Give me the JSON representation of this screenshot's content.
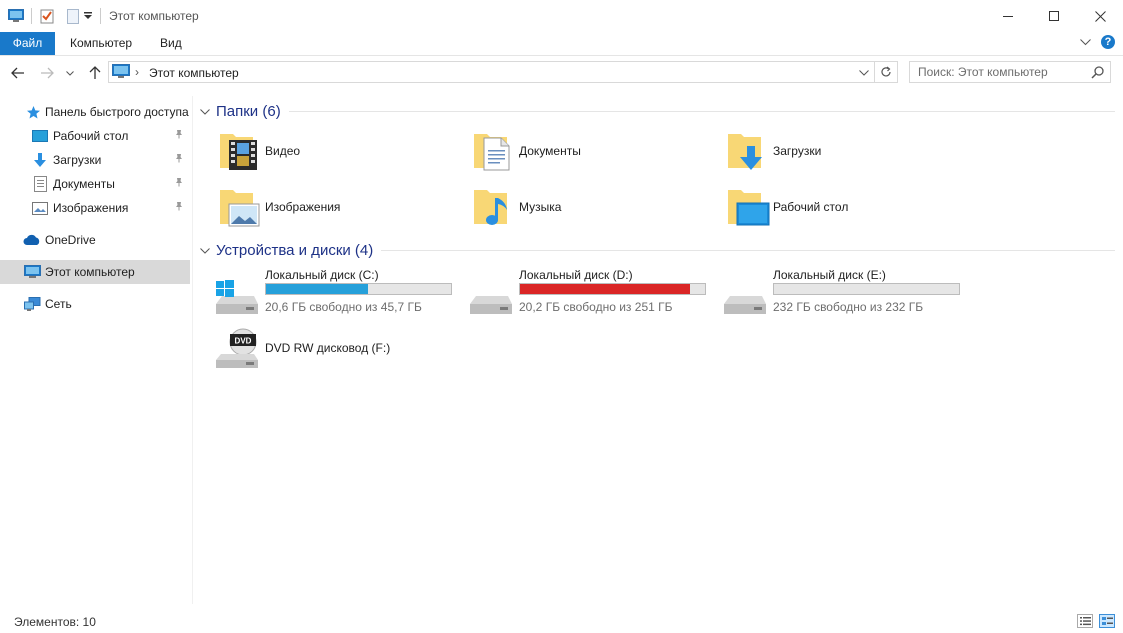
{
  "window": {
    "title": "Этот компьютер",
    "minimize": "—",
    "maximize": "☐",
    "close": "✕"
  },
  "ribbon": {
    "tabs": [
      {
        "label": "Файл"
      },
      {
        "label": "Компьютер"
      },
      {
        "label": "Вид"
      }
    ],
    "help": "?"
  },
  "address": {
    "path": "Этот компьютер",
    "search_placeholder": "Поиск: Этот компьютер"
  },
  "nav": {
    "quick_access": "Панель быстрого доступа",
    "items": [
      {
        "label": "Рабочий стол",
        "pinned": true
      },
      {
        "label": "Загрузки",
        "pinned": true
      },
      {
        "label": "Документы",
        "pinned": true
      },
      {
        "label": "Изображения",
        "pinned": true
      }
    ],
    "onedrive": "OneDrive",
    "this_pc": "Этот компьютер",
    "network": "Сеть"
  },
  "folders": {
    "header": "Папки (6)",
    "items": [
      {
        "label": "Видео",
        "icon": "video-folder-icon"
      },
      {
        "label": "Документы",
        "icon": "documents-folder-icon"
      },
      {
        "label": "Загрузки",
        "icon": "downloads-folder-icon"
      },
      {
        "label": "Изображения",
        "icon": "pictures-folder-icon"
      },
      {
        "label": "Музыка",
        "icon": "music-folder-icon"
      },
      {
        "label": "Рабочий стол",
        "icon": "desktop-folder-icon"
      }
    ]
  },
  "drives": {
    "header": "Устройства и диски (4)",
    "items": [
      {
        "name": "Локальный диск (C:)",
        "free_text": "20,6 ГБ свободно из 45,7 ГБ",
        "used_fraction": 0.55,
        "bar_color": "#26a0da"
      },
      {
        "name": "Локальный диск (D:)",
        "free_text": "20,2 ГБ свободно из 251 ГБ",
        "used_fraction": 0.92,
        "bar_color": "#da2626"
      },
      {
        "name": "Локальный диск (E:)",
        "free_text": "232 ГБ свободно из 232 ГБ",
        "used_fraction": 0.0,
        "bar_color": "#26a0da"
      },
      {
        "name": "DVD RW дисковод (F:)",
        "free_text": "",
        "used_fraction": null,
        "bar_color": ""
      }
    ]
  },
  "status": {
    "items_count": "Элементов: 10"
  },
  "colors": {
    "accent": "#1979ca",
    "header_text": "#1e3287",
    "folder_yellow": "#f8d775"
  }
}
